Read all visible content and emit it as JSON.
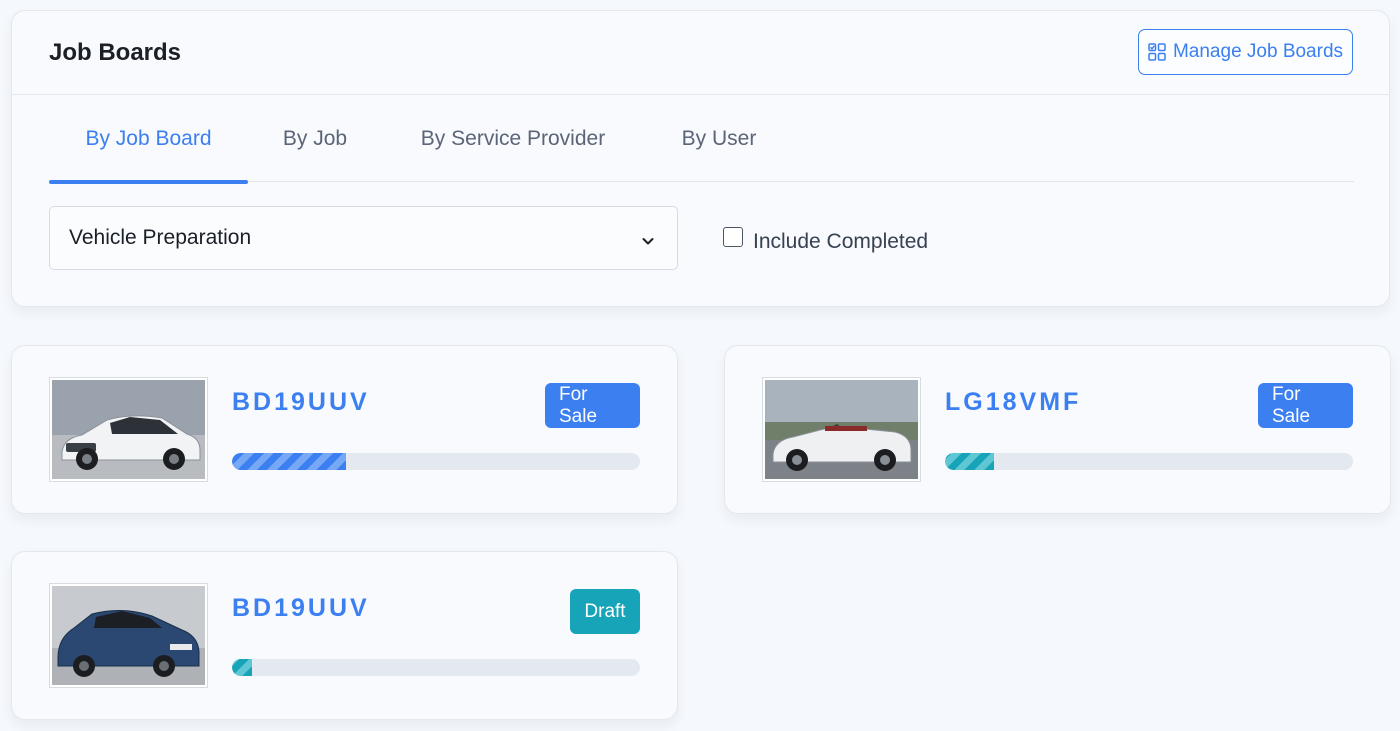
{
  "header": {
    "title": "Job Boards",
    "manage_button": "Manage Job Boards"
  },
  "tabs": [
    {
      "label": "By Job Board",
      "active": true
    },
    {
      "label": "By Job",
      "active": false
    },
    {
      "label": "By Service Provider",
      "active": false
    },
    {
      "label": "By User",
      "active": false
    }
  ],
  "filters": {
    "board_select": "Vehicle Preparation",
    "include_completed_label": "Include Completed",
    "include_completed_checked": false
  },
  "colors": {
    "accent": "#3b7ff0",
    "teal": "#17a3b8",
    "background": "#f5f8fc"
  },
  "cards": [
    {
      "plate": "BD19UUV",
      "status": "For Sale",
      "status_color": "#3b7ff0",
      "progress_percent": 28,
      "progress_color": "blue",
      "vehicle_image": "white-hatchback"
    },
    {
      "plate": "LG18VMF",
      "status": "For Sale",
      "status_color": "#3b7ff0",
      "progress_percent": 12,
      "progress_color": "teal",
      "vehicle_image": "white-convertible"
    },
    {
      "plate": "BD19UUV",
      "status": "Draft",
      "status_color": "#17a3b8",
      "progress_percent": 5,
      "progress_color": "teal",
      "vehicle_image": "blue-hatchback"
    }
  ]
}
